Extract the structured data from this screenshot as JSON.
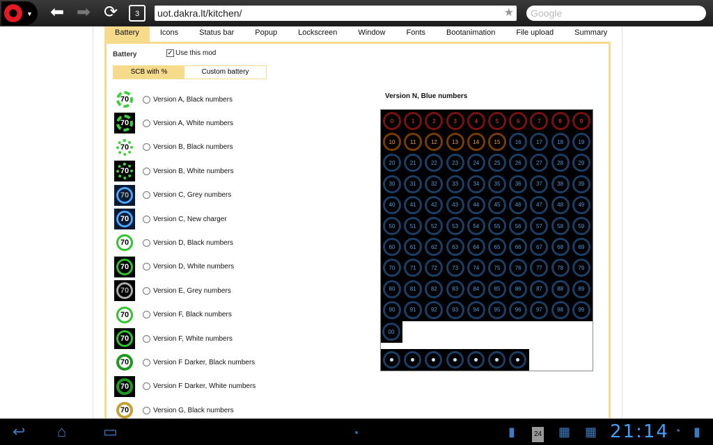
{
  "browser": {
    "url": "uot.dakra.lt/kitchen/",
    "search_placeholder": "Google",
    "tab_count": "3",
    "icons": [
      "opera-logo",
      "back-arrow",
      "forward-arrow",
      "reload",
      "star"
    ]
  },
  "tabs": [
    "Battery",
    "Icons",
    "Status bar",
    "Popup",
    "Lockscreen",
    "Window",
    "Fonts",
    "Bootanimation",
    "File upload",
    "Summary"
  ],
  "panel": {
    "title": "Battery",
    "use_mod_label": "Use this mod",
    "use_mod_checked": true,
    "subtabs": [
      "SCB with %",
      "Custom battery"
    ]
  },
  "options": [
    {
      "label": "Version A, Black numbers",
      "num": "70"
    },
    {
      "label": "Version A, White numbers",
      "num": "70"
    },
    {
      "label": "Version B, Black numbers",
      "num": "70"
    },
    {
      "label": "Version B, White numbers",
      "num": "70"
    },
    {
      "label": "Version C, Grey numbers",
      "num": "70"
    },
    {
      "label": "Version C, New charger",
      "num": "70"
    },
    {
      "label": "Version D, Black numbers",
      "num": "70"
    },
    {
      "label": "Version D, White numbers",
      "num": "70"
    },
    {
      "label": "Version E, Grey numbers",
      "num": "70"
    },
    {
      "label": "Version F, Black numbers",
      "num": "70"
    },
    {
      "label": "Version F, White numbers",
      "num": "70"
    },
    {
      "label": "Version F Darker, Black numbers",
      "num": "70"
    },
    {
      "label": "Version F Darker, White numbers",
      "num": "70"
    },
    {
      "label": "Version G, Black numbers",
      "num": "70"
    }
  ],
  "preview": {
    "title": "Version N, Blue numbers",
    "extra_label": "00"
  },
  "system": {
    "clock": "21:14",
    "notif_badge": "24"
  },
  "colors": {
    "accent": "#f7db8c",
    "clock": "#3fa1ff"
  }
}
